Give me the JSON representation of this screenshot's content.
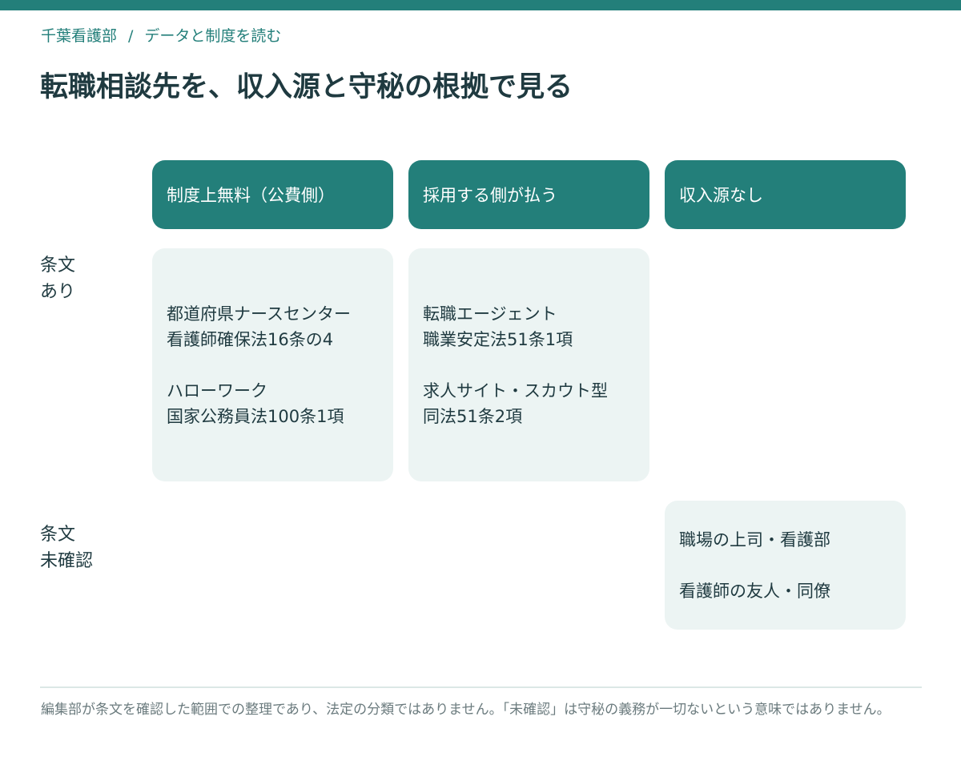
{
  "breadcrumb": {
    "section": "千葉看護部",
    "separator": "/",
    "current": "データと制度を読む"
  },
  "title": "転職相談先を、収入源と守秘の根拠で見る",
  "columns": [
    "制度上無料（公費側）",
    "採用する側が払う",
    "収入源なし"
  ],
  "rows": [
    {
      "label": [
        "条文",
        "あり"
      ]
    },
    {
      "label": [
        "条文",
        "未確認"
      ]
    }
  ],
  "cells": {
    "statute_public": [
      {
        "name": "都道府県ナースセンター",
        "basis": "看護師確保法16条の4"
      },
      {
        "name": "ハローワーク",
        "basis": "国家公務員法100条1項"
      }
    ],
    "statute_employer": [
      {
        "name": "転職エージェント",
        "basis": "職業安定法51条1項"
      },
      {
        "name": "求人サイト・スカウト型",
        "basis": "同法51条2項"
      }
    ],
    "unverified_none": [
      {
        "name": "職場の上司・看護部"
      },
      {
        "name": "看護師の友人・同僚"
      }
    ]
  },
  "colors": {
    "accent": "#237f7a",
    "cell_bg": "#ecf4f3",
    "text": "#1f3a40",
    "muted": "#6b7b7e"
  },
  "footnote": "編集部が条文を確認した範囲での整理であり、法定の分類ではありません。「未確認」は守秘の義務が一切ないという意味ではありません。"
}
